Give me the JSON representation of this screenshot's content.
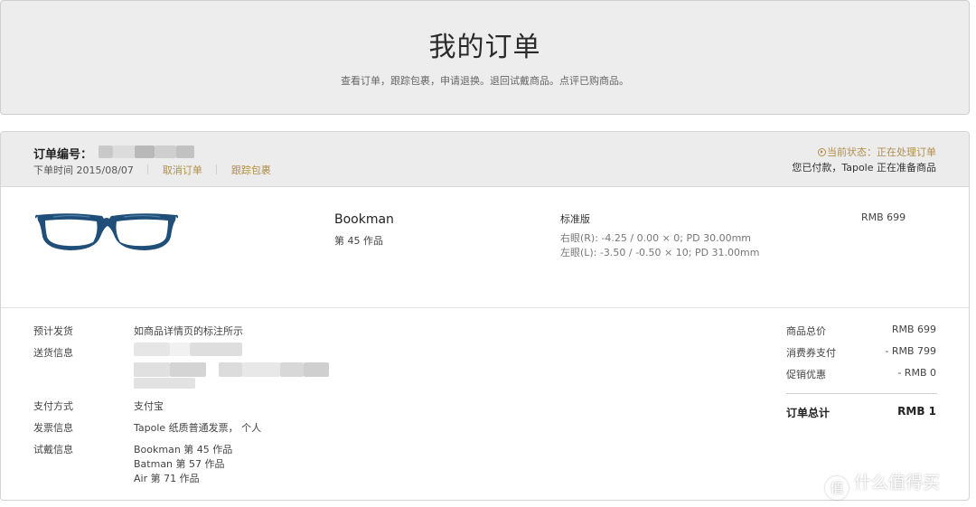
{
  "header": {
    "title": "我的订单",
    "subtitle": "查看订单，跟踪包裹，申请退换。退回试戴商品。点评已购商品。"
  },
  "order": {
    "number_label": "订单编号：",
    "order_time": "下单时间 2015/08/07",
    "cancel_link": "取消订单",
    "track_link": "跟踪包裹",
    "status": "当前状态：正在处理订单",
    "status_desc": "您已付款，Tapole 正在准备商品"
  },
  "item": {
    "icon": "eyeglasses-image",
    "name": "Bookman",
    "sub": "第 45 作品",
    "variant": "标准版",
    "rx_right": "右眼(R): -4.25 / 0.00 × 0; PD 30.00mm",
    "rx_left": "左眼(L): -3.50 / -0.50 × 10; PD 31.00mm",
    "price": "RMB 699"
  },
  "details": {
    "ship_label": "预计发货",
    "ship_value": "如商品详情页的标注所示",
    "address_label": "送货信息",
    "payment_label": "支付方式",
    "payment_value": "支付宝",
    "invoice_label": "发票信息",
    "invoice_value": "Tapole 纸质普通发票， 个人",
    "trial_label": "试戴信息",
    "trial_items": [
      "Bookman 第 45 作品",
      "Batman 第 57 作品",
      "Air 第 71 作品"
    ]
  },
  "summary": {
    "subtotal_label": "商品总价",
    "subtotal_value": "RMB 699",
    "coupon_label": "消费券支付",
    "coupon_value": "- RMB 799",
    "promo_label": "促销优惠",
    "promo_value": "- RMB 0",
    "total_label": "订单总计",
    "total_value": "RMB 1"
  },
  "watermark": {
    "text": "什么值得买",
    "icon": "zhi-logo-icon",
    "icon_glyph": "值"
  },
  "colors": {
    "accent_gold": "#b08e4a",
    "header_bg": "#ededed",
    "frame_blue": "#1f4f78"
  }
}
